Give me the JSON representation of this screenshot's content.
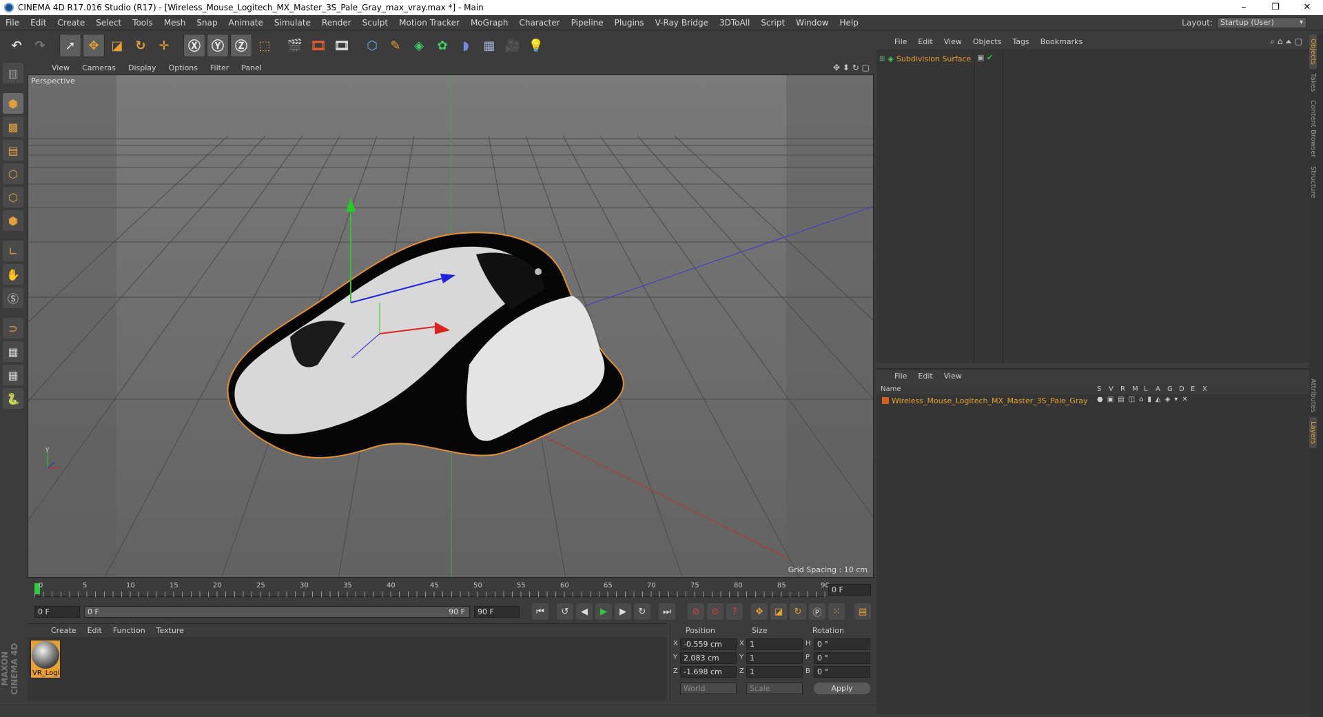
{
  "title": "CINEMA 4D R17.016 Studio (R17) - [Wireless_Mouse_Logitech_MX_Master_3S_Pale_Gray_max_vray.max *] - Main",
  "window_controls": [
    "–",
    "❐",
    "✕"
  ],
  "menu": [
    "File",
    "Edit",
    "Create",
    "Select",
    "Tools",
    "Mesh",
    "Snap",
    "Animate",
    "Simulate",
    "Render",
    "Sculpt",
    "Motion Tracker",
    "MoGraph",
    "Character",
    "Pipeline",
    "Plugins",
    "V-Ray Bridge",
    "3DToAll",
    "Script",
    "Window",
    "Help"
  ],
  "layout": {
    "label": "Layout:",
    "value": "Startup (User)"
  },
  "viewport": {
    "menu": [
      "View",
      "Cameras",
      "Display",
      "Options",
      "Filter",
      "Panel"
    ],
    "label": "Perspective",
    "grid_spacing": "Grid Spacing : 10 cm"
  },
  "timeline": {
    "ticks": [
      "0",
      "5",
      "10",
      "15",
      "20",
      "25",
      "30",
      "35",
      "40",
      "45",
      "50",
      "55",
      "60",
      "65",
      "70",
      "75",
      "80",
      "85",
      "90"
    ],
    "end_field": "0 F",
    "start_field": "0 F",
    "range_left": "0 F",
    "range_right": "90 F",
    "end_frame": "90 F"
  },
  "material": {
    "menu": [
      "Create",
      "Edit",
      "Function",
      "Texture"
    ],
    "item_label": "VR_Logi"
  },
  "coords": {
    "headers": [
      "Position",
      "Size",
      "Rotation"
    ],
    "rows": [
      {
        "axis": "X",
        "pos": "-0.559 cm",
        "saxis": "X",
        "size": "1",
        "raxis": "H",
        "rot": "0 °"
      },
      {
        "axis": "Y",
        "pos": "2.083 cm",
        "saxis": "Y",
        "size": "1",
        "raxis": "P",
        "rot": "0 °"
      },
      {
        "axis": "Z",
        "pos": "-1.698 cm",
        "saxis": "Z",
        "size": "1",
        "raxis": "B",
        "rot": "0 °"
      }
    ],
    "world": "World",
    "scale": "Scale",
    "apply": "Apply"
  },
  "objects": {
    "menu": [
      "File",
      "Edit",
      "View",
      "Objects",
      "Tags",
      "Bookmarks"
    ],
    "item": "Subdivision Surface"
  },
  "layers": {
    "menu": [
      "File",
      "Edit",
      "View"
    ],
    "columns": [
      "Name",
      "S",
      "V",
      "R",
      "M",
      "L",
      "A",
      "G",
      "D",
      "E",
      "X"
    ],
    "item": "Wireless_Mouse_Logitech_MX_Master_3S_Pale_Gray"
  },
  "side_tabs": [
    "Objects",
    "Takes",
    "Content Browser",
    "Structure",
    "Attributes",
    "Layers"
  ],
  "brand": "MAXON CINEMA 4D",
  "colors": {
    "accent": "#e8a030",
    "viewport_bg": "#6c6c6c",
    "panel_bg": "#3c3c3c"
  }
}
